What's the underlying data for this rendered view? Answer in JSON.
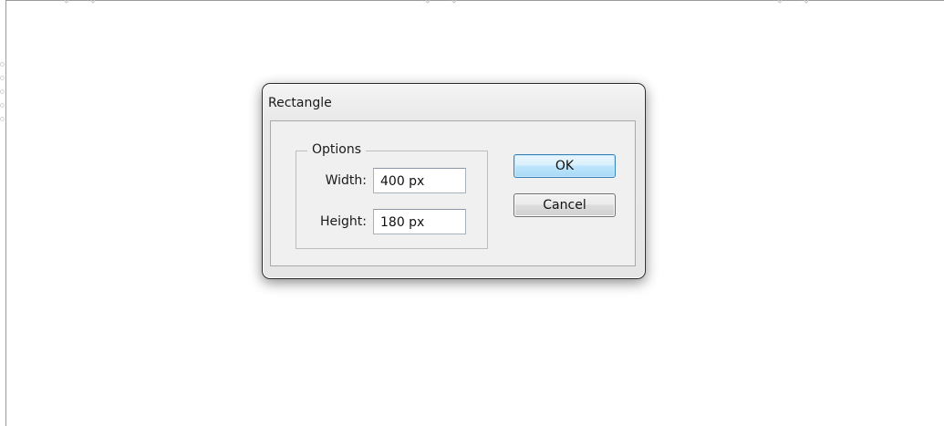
{
  "dialog": {
    "title": "Rectangle",
    "options_group": {
      "legend": "Options",
      "fields": [
        {
          "label": "Width:",
          "value": "400 px"
        },
        {
          "label": "Height:",
          "value": "180 px"
        }
      ]
    },
    "buttons": {
      "ok_label": "OK",
      "cancel_label": "Cancel"
    }
  },
  "colors": {
    "ok_button_border": "#3c7fb1",
    "ok_button_fill": "#bee6fd",
    "dialog_background": "#f0f0f0"
  }
}
